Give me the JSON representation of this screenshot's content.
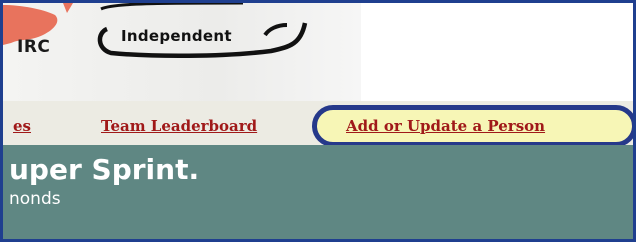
{
  "header": {
    "logo_left_text": "IRC",
    "logo_main_text": "Independent"
  },
  "nav": {
    "items": [
      {
        "label": "es"
      },
      {
        "label": "Team Leaderboard"
      },
      {
        "label": "Add or Update a Person",
        "highlighted": true
      }
    ],
    "link_color": "#a01919",
    "highlight_fill": "#f7f6b6",
    "highlight_stroke": "#26398a"
  },
  "hero": {
    "title": "uper Sprint.",
    "subtitle": "nonds",
    "background": "#5f8783"
  },
  "frame": {
    "border_color": "#1f3f8f"
  }
}
